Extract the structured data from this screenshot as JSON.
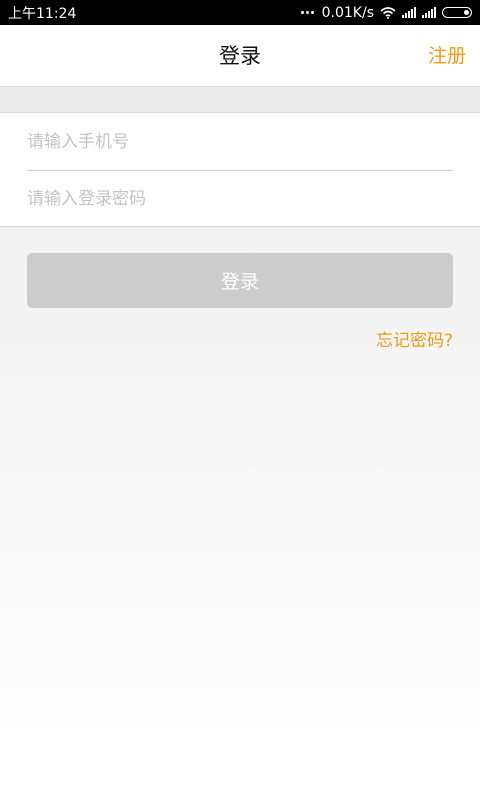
{
  "status_bar": {
    "time": "上午11:24",
    "network_speed": "0.01K/s",
    "icons": [
      "more-dots-icon",
      "wifi-icon",
      "signal-icon",
      "signal-icon",
      "battery-icon"
    ]
  },
  "header": {
    "title": "登录",
    "register_label": "注册"
  },
  "form": {
    "phone_placeholder": "请输入手机号",
    "phone_value": "",
    "password_placeholder": "请输入登录密码",
    "password_value": ""
  },
  "actions": {
    "login_label": "登录",
    "forgot_password_label": "忘记密码?"
  },
  "colors": {
    "accent": "#f09a14",
    "button_disabled": "#cccccc",
    "status_bar": "#000000"
  }
}
